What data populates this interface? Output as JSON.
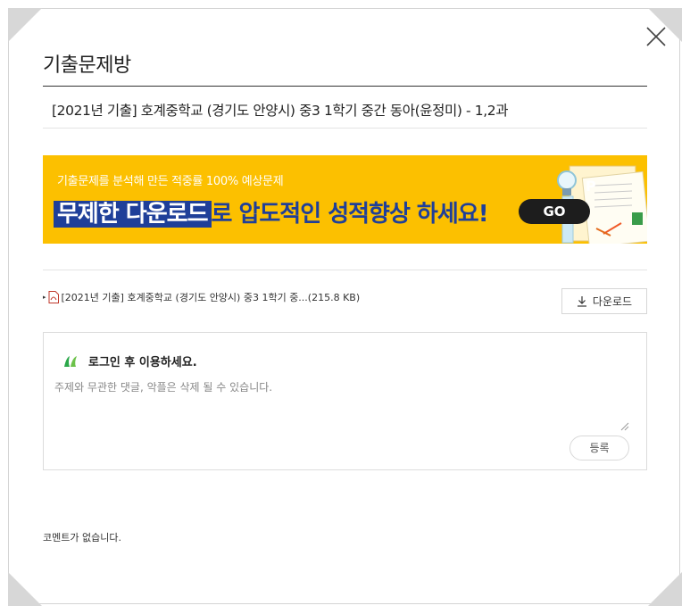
{
  "header": {
    "title": "기출문제방"
  },
  "post": {
    "subject": "[2021년 기출] 호계중학교 (경기도 안양시) 중3 1학기 중간 동아(윤정미) - 1,2과"
  },
  "banner": {
    "subtitle": "기출문제를 분석해 만든 적중률 100% 예상문제",
    "highlight": "무제한 다운로드",
    "headline_rest": "로 압도적인 성적향상 하세요!",
    "go_label": "GO",
    "color": "#fcc000",
    "accent": "#1f3f99"
  },
  "attachment": {
    "filename": "[2021년 기출] 호계중학교 (경기도 안양시) 중3 1학기 중...(215.8 KB)",
    "download_label": "다운로드"
  },
  "comment_form": {
    "login_prompt": "로그인 후 이용하세요.",
    "placeholder": "주제와 무관한 댓글, 악플은 삭제 될 수 있습니다.",
    "submit_label": "등록"
  },
  "comments": {
    "empty_text": "코멘트가 없습니다."
  }
}
